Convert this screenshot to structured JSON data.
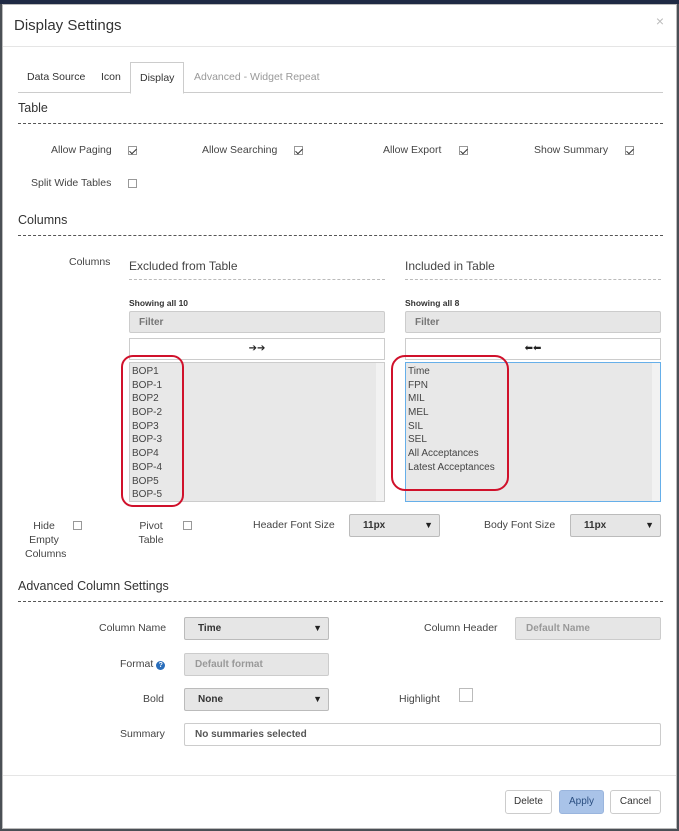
{
  "dialog": {
    "title": "Display Settings",
    "close_glyph": "×"
  },
  "tabs": [
    {
      "label": "Data Source"
    },
    {
      "label": "Icon"
    },
    {
      "label": "Display"
    },
    {
      "label": "Advanced - Widget Repeat"
    }
  ],
  "active_tab": "Display",
  "table_section": {
    "title": "Table",
    "options": [
      {
        "label": "Allow Paging",
        "checked": true
      },
      {
        "label": "Allow Searching",
        "checked": true
      },
      {
        "label": "Allow Export",
        "checked": true
      },
      {
        "label": "Show Summary",
        "checked": true
      },
      {
        "label": "Split Wide Tables",
        "checked": false
      }
    ]
  },
  "columns_section": {
    "title": "Columns",
    "label": "Columns",
    "excluded": {
      "heading": "Excluded from Table",
      "showing": "Showing all 10",
      "filter_placeholder": "Filter",
      "move_glyph": "➔➔",
      "items": [
        "BOP1",
        "BOP-1",
        "BOP2",
        "BOP-2",
        "BOP3",
        "BOP-3",
        "BOP4",
        "BOP-4",
        "BOP5",
        "BOP-5"
      ]
    },
    "included": {
      "heading": "Included in Table",
      "showing": "Showing all 8",
      "filter_placeholder": "Filter",
      "move_glyph": "⬅⬅",
      "items": [
        "Time",
        "FPN",
        "MIL",
        "MEL",
        "SIL",
        "SEL",
        "All Acceptances",
        "Latest Acceptances"
      ]
    },
    "hide_empty": {
      "label": "Hide Empty Columns",
      "checked": false
    },
    "pivot": {
      "label": "Pivot Table",
      "checked": false
    },
    "header_font": {
      "label": "Header Font Size",
      "value": "11px"
    },
    "body_font": {
      "label": "Body Font Size",
      "value": "11px"
    },
    "annotation_color": "#d0112b"
  },
  "advanced_section": {
    "title": "Advanced Column Settings",
    "column_name": {
      "label": "Column Name",
      "value": "Time"
    },
    "column_header": {
      "label": "Column Header",
      "placeholder": "Default Name"
    },
    "format": {
      "label": "Format",
      "placeholder": "Default format",
      "help_glyph": "?"
    },
    "bold": {
      "label": "Bold",
      "value": "None"
    },
    "highlight": {
      "label": "Highlight",
      "checked": false
    },
    "summary": {
      "label": "Summary",
      "value": "No summaries selected"
    }
  },
  "footer": {
    "delete": "Delete",
    "apply": "Apply",
    "cancel": "Cancel"
  },
  "icons": {
    "caret": "▼",
    "close": "close-icon",
    "help": "help-icon"
  }
}
